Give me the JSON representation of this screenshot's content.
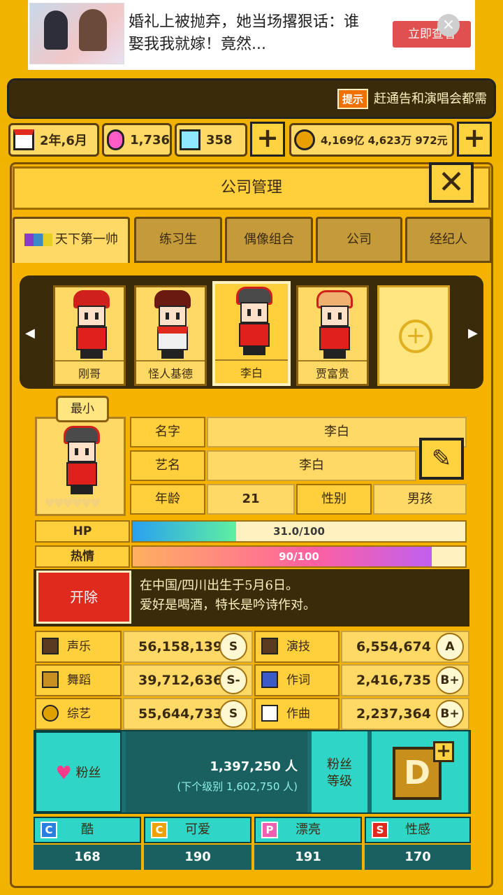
{
  "ad": {
    "text": "婚礼上被抛弃，她当场撂狠话：谁娶我我就嫁！竟然...",
    "button": "立即查看",
    "close": "×"
  },
  "hint": {
    "badge": "提示",
    "text": "赶通告和演唱会都需"
  },
  "resources": {
    "date": "2年,6月",
    "gems": "1,736",
    "diamonds": "358",
    "money": "4,169亿 4,623万 972元",
    "plus": "+"
  },
  "panel": {
    "title": "公司管理",
    "close": "✕"
  },
  "tabs": [
    "天下第一帅",
    "练习生",
    "偶像组合",
    "公司",
    "经纪人"
  ],
  "roster": [
    "刚哥",
    "怪人基德",
    "李白",
    "贾富贵"
  ],
  "add_symbol": "+",
  "arrows": {
    "left": "◀",
    "right": "▶"
  },
  "profile": {
    "badge": "最小",
    "hearts": "♥♥♥♥♥♥",
    "name_label": "名字",
    "name": "李白",
    "stage_label": "艺名",
    "stage_name": "李白",
    "age_label": "年龄",
    "age": "21",
    "gender_label": "性别",
    "gender": "男孩",
    "edit": "✎"
  },
  "bars": {
    "hp_label": "HP",
    "hp_text": "31.0/100",
    "hp_value": 31,
    "passion_label": "热情",
    "passion_text": "90/100",
    "passion_value": 90
  },
  "fire_label": "开除",
  "bio": [
    "在中国/四川出生于5月6日。",
    "爱好是喝酒，特长是吟诗作对。"
  ],
  "stats": [
    {
      "label": "声乐",
      "value": "56,158,139",
      "grade": "S"
    },
    {
      "label": "演技",
      "value": "6,554,674",
      "grade": "A"
    },
    {
      "label": "舞蹈",
      "value": "39,712,636",
      "grade": "S-"
    },
    {
      "label": "作词",
      "value": "2,416,735",
      "grade": "B+"
    },
    {
      "label": "综艺",
      "value": "55,644,733",
      "grade": "S"
    },
    {
      "label": "作曲",
      "value": "2,237,364",
      "grade": "B+"
    }
  ],
  "fans": {
    "label": "粉丝",
    "count": "1,397,250 人",
    "next": "(下个级别 1,602,750 人)",
    "level_label": "粉丝等级",
    "level": "D",
    "plus": "+"
  },
  "traits": [
    {
      "icon": "C",
      "label": "酷",
      "value": "168"
    },
    {
      "icon": "C",
      "label": "可爱",
      "value": "190"
    },
    {
      "icon": "P",
      "label": "漂亮",
      "value": "191"
    },
    {
      "icon": "S",
      "label": "性感",
      "value": "170"
    }
  ],
  "colors": {
    "gold": "#f5b300",
    "dark": "#3a2c0a",
    "teal": "#2fd6c8",
    "red": "#e02a1e"
  }
}
